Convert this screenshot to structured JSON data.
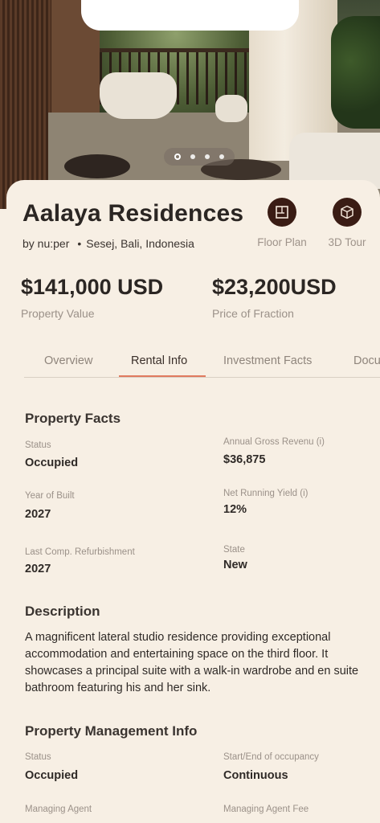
{
  "hero": {
    "carousel_dots": 4,
    "active_dot": 0
  },
  "property": {
    "name": "Aalaya Residences",
    "developer": "by nu:per",
    "separator": "•",
    "location": "Sesej, Bali, Indonesia"
  },
  "actions": {
    "floor_plan": "Floor Plan",
    "tour_3d": "3D Tour"
  },
  "pricing": {
    "property_value": "$141,000 USD",
    "property_value_label": "Property Value",
    "fraction_price": "$23,200USD",
    "fraction_price_label": "Price of Fraction"
  },
  "tabs": [
    {
      "label": "Overview",
      "active": false
    },
    {
      "label": "Rental Info",
      "active": true
    },
    {
      "label": "Investment Facts",
      "active": false
    },
    {
      "label": "Documents",
      "active": false
    }
  ],
  "property_facts": {
    "title": "Property Facts",
    "status_label": "Status",
    "status_value": "Occupied",
    "revenue_label": "Annual Gross Revenu (i)",
    "revenue_value": "$36,875",
    "year_label": "Year of Built",
    "year_value": "2027",
    "yield_label": "Net Running Yield (i)",
    "yield_value": "12%",
    "refurb_label": "Last Comp. Refurbishment",
    "refurb_value": "2027",
    "state_label": "State",
    "state_value": "New"
  },
  "description": {
    "title": "Description",
    "text": "A magnificent lateral studio residence  providing exceptional accommodation and entertaining space on the third floor. It showcases a principal suite with a walk-in wardrobe and en suite bathroom featuring his and her sink."
  },
  "management": {
    "title": "Property Management Info",
    "status_label": "Status",
    "status_value": "Occupied",
    "occupancy_label": "Start/End of occupancy",
    "occupancy_value": "Continuous",
    "agent_label": "Managing Agent",
    "agent_fee_label": "Managing Agent Fee"
  },
  "colors": {
    "background": "#f7efe4",
    "accent": "#e07a5f",
    "action_circle": "#3a1c14"
  }
}
